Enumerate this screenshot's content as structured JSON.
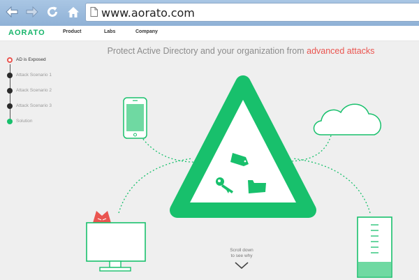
{
  "browser": {
    "url": "www.aorato.com",
    "icons": [
      "back-arrow-icon",
      "forward-arrow-icon",
      "reload-icon",
      "home-icon",
      "page-icon"
    ]
  },
  "site": {
    "logo": "AORATO",
    "nav": [
      "Product",
      "Labs",
      "Company"
    ]
  },
  "steps": [
    {
      "label": "AD is Exposed",
      "state": "active"
    },
    {
      "label": "Attack Scenario 1",
      "state": "done"
    },
    {
      "label": "Attack Scenario 2",
      "state": "done"
    },
    {
      "label": "Attack Scenario 3",
      "state": "done"
    },
    {
      "label": "Solution",
      "state": "solution"
    }
  ],
  "headline": {
    "text": "Protect Active Directory and your organization from ",
    "accent": "advanced attacks"
  },
  "scroll": {
    "line1": "Scroll down",
    "line2": "to see why"
  },
  "colors": {
    "brand_green": "#18c06c",
    "light_green": "#6fd9a2",
    "accent_red": "#ea5550",
    "background": "#efefef"
  },
  "illustration": {
    "icons": [
      "warning-triangle-icon",
      "tag-icon",
      "key-icon",
      "folder-icon",
      "phone-icon",
      "cloud-icon",
      "monitor-icon",
      "attacker-icon",
      "server-icon"
    ]
  }
}
